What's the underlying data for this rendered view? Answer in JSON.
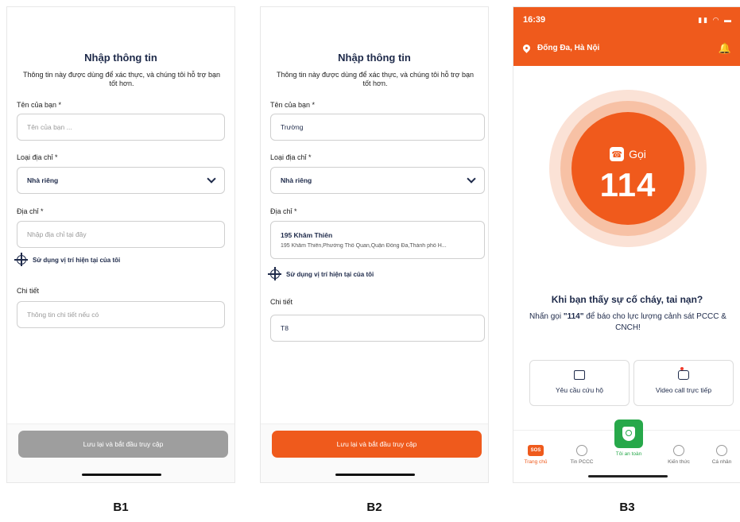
{
  "form": {
    "title": "Nhập thông tin",
    "subtitle": "Thông tin này được dùng để xác thực, và chúng tôi hỗ trợ bạn tốt hơn.",
    "name_label": "Tên của bạn *",
    "name_placeholder": "Tên của bạn ...",
    "address_type_label": "Loại địa chỉ *",
    "address_type_value": "Nhà riêng",
    "address_label": "Địa chỉ *",
    "address_placeholder": "Nhập địa chỉ tại đây",
    "use_location": "Sử dụng vị trí hiện tại của tôi",
    "detail_label": "Chi tiết",
    "detail_placeholder": "Thông tin chi tiết nếu có",
    "submit_label": "Lưu lại và bắt đầu truy cập"
  },
  "b2_values": {
    "name": "Trường",
    "address_main": "195 Khâm Thiên",
    "address_full": "195 Khâm Thiên,Phường Thổ Quan,Quận Đống Đa,Thành phố H...",
    "detail": "T8"
  },
  "home": {
    "time": "16:39",
    "location": "Đống Đa,  Hà Nội",
    "call_label": "Gọi",
    "call_number": "114",
    "question": "Khi bạn thấy sự cố cháy, tai nạn?",
    "instruction_pre": "Nhấn gọi ",
    "instruction_num": "\"114\"",
    "instruction_post": " để báo cho lực lượng cảnh sát PCCC & CNCH!",
    "card_rescue": "Yêu cầu cứu hộ",
    "card_video": "Video call trực tiếp",
    "tabs": [
      "Trang chủ",
      "Tin PCCC",
      "Tôi an toàn",
      "Kiến thức",
      "Cá nhân"
    ],
    "sos": "SOS"
  },
  "captions": [
    "B1",
    "B2",
    "B3"
  ],
  "colors": {
    "accent": "#ef5a1c",
    "disabled": "#9e9e9e",
    "safe": "#27a84a"
  }
}
